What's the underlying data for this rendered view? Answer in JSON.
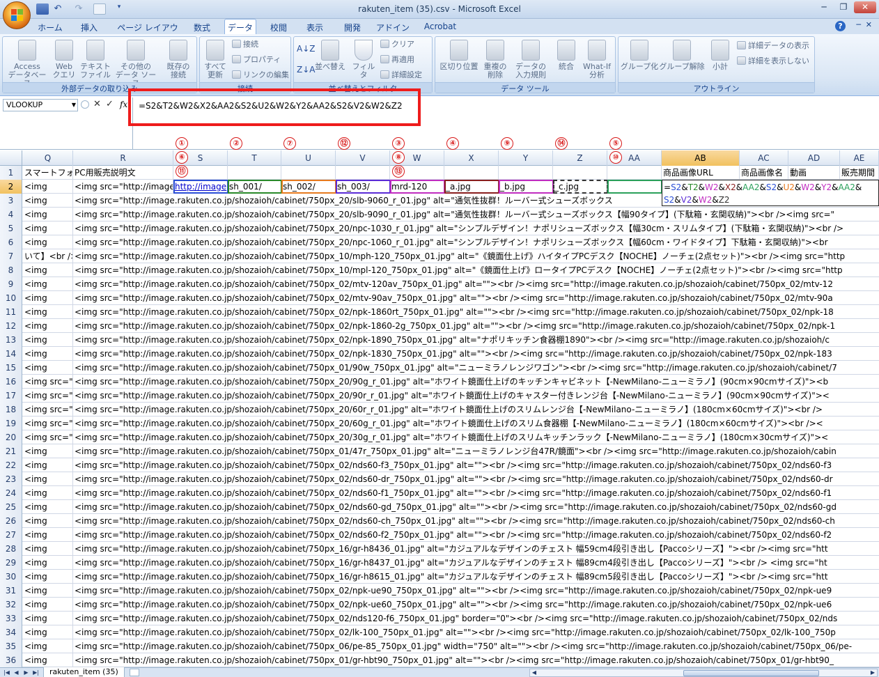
{
  "window": {
    "title": "rakuten_item (35).csv - Microsoft Excel",
    "controls": {
      "minimize": "─",
      "maximize": "❐",
      "close": "✕"
    }
  },
  "ribbon_tabs": [
    "ホーム",
    "挿入",
    "ページ レイアウト",
    "数式",
    "データ",
    "校閲",
    "表示",
    "開発",
    "アドイン",
    "Acrobat"
  ],
  "active_tab": "データ",
  "help": "?",
  "ribbon": {
    "external_data": {
      "label": "外部データの取り込み",
      "access": [
        "Access",
        "データベース"
      ],
      "web": [
        "Web",
        "クエリ"
      ],
      "text": [
        "テキスト",
        "ファイル"
      ],
      "other": [
        "その他の",
        "データ ソース"
      ],
      "existing": [
        "既存の",
        "接続"
      ]
    },
    "connections": {
      "label": "接続",
      "refresh_all": [
        "すべて",
        "更新"
      ],
      "connect": "接続",
      "properties": "プロパティ",
      "edit_links": "リンクの編集"
    },
    "sort_filter": {
      "label": "並べ替えとフィルタ",
      "sort": "並べ替え",
      "filter": "フィルタ",
      "clear": "クリア",
      "reapply": "再適用",
      "advanced": "詳細設定"
    },
    "data_tools": {
      "label": "データ ツール",
      "text_to_columns": "区切り位置",
      "remove_dup": [
        "重複の",
        "削除"
      ],
      "validation": [
        "データの",
        "入力規則"
      ],
      "consolidate": "統合",
      "whatif": [
        "What-If",
        "分析"
      ]
    },
    "outline": {
      "label": "アウトライン",
      "group": "グループ化",
      "ungroup": "グループ解除",
      "subtotal": "小計",
      "show_detail": "詳細データの表示",
      "hide_detail": "詳細を表示しない"
    }
  },
  "name_box": "VLOOKUP",
  "fx_symbols": {
    "cancel": "✕",
    "enter": "✓",
    "fx": "fx"
  },
  "formula": "=S2&T2&W2&X2&AA2&S2&U2&W2&Y2&AA2&S2&V2&W2&Z2",
  "columns": [
    "Q",
    "R",
    "S",
    "T",
    "U",
    "V",
    "W",
    "X",
    "Y",
    "Z",
    "AA",
    "AB",
    "AC",
    "AD",
    "AE"
  ],
  "selected_column": "AB",
  "selected_row": "2",
  "row1": {
    "Q": "スマートフォ",
    "R": "PC用販売説明文",
    "AB": "商品画像URL",
    "AC": "商品画像名",
    "AD": "動画",
    "AE": "販売期間"
  },
  "row2": {
    "Q": "<img",
    "R": "<img src=\"http://image",
    "S": "http://image",
    "T": "sh_001/",
    "U": "sh_002/",
    "V": "sh_003/",
    "W": "mrd-120",
    "X": "_a.jpg",
    "Y": "_b.jpg",
    "Z": "_c.jpg",
    "AB_line1": "=S2&T2&W2&X2&AA2&S2&U2&W2&Y2&AA2&",
    "AB_line2": "S2&V2&W2&Z2"
  },
  "circled_numbers": {
    "S": [
      "①",
      "⑥",
      "⑪"
    ],
    "T": [
      "②"
    ],
    "U": [
      "⑦"
    ],
    "V": [
      "⑫"
    ],
    "W": [
      "③",
      "⑧",
      "⑬"
    ],
    "X": [
      "④"
    ],
    "Y": [
      "⑨"
    ],
    "Z": [
      "⑭"
    ],
    "AA": [
      "⑤",
      "⑩"
    ]
  },
  "rows": [
    {
      "n": "3",
      "q": "<img",
      "r": "<img src=\"http://image.rakuten.co.jp/shozaioh/cabinet/750px_20/slb-9060_r_01.jpg\" alt=\"通気性抜群！ルーバー式シューズボックス"
    },
    {
      "n": "4",
      "q": "<img",
      "r": "<img src=\"http://image.rakuten.co.jp/shozaioh/cabinet/750px_20/slb-9090_r_01.jpg\" alt=\"通気性抜群！ルーバー式シューズボックス【幅90タイプ】(下駄箱・玄関収納)\"><br /><img src=\""
    },
    {
      "n": "5",
      "q": "<img",
      "r": "<img src=\"http://image.rakuten.co.jp/shozaioh/cabinet/750px_20/npc-1030_r_01.jpg\" alt=\"シンプルデザイン！ナポリシューズボックス【幅30cm・スリムタイプ】(下駄箱・玄関収納)\"><br />"
    },
    {
      "n": "6",
      "q": "<img",
      "r": "<img src=\"http://image.rakuten.co.jp/shozaioh/cabinet/750px_20/npc-1060_r_01.jpg\" alt=\"シンプルデザイン！ナポリシューズボックス【幅60cm・ワイドタイプ】下駄箱・玄関収納)\"><br"
    },
    {
      "n": "7",
      "q": "いて】<br />",
      "r": "<img src=\"http://image.rakuten.co.jp/shozaioh/cabinet/750px_10/mph-120_750px_01.jpg\" alt=\"《鏡面仕上げ》ハイタイプPCデスク【NOCHE】ノーチェ(2点セット)\"><br /><img src=\"http"
    },
    {
      "n": "8",
      "q": "<img",
      "r": "<img src=\"http://image.rakuten.co.jp/shozaioh/cabinet/750px_10/mpl-120_750px_01.jpg\" alt=\"《鏡面仕上げ》ロータイプPCデスク【NOCHE】ノーチェ(2点セット)\"><br /><img src=\"http"
    },
    {
      "n": "9",
      "q": "<img",
      "r": "<img src=\"http://image.rakuten.co.jp/shozaioh/cabinet/750px_02/mtv-120av_750px_01.jpg\" alt=\"\"><br /><img src=\"http://image.rakuten.co.jp/shozaioh/cabinet/750px_02/mtv-12"
    },
    {
      "n": "10",
      "q": "<img",
      "r": "<img src=\"http://image.rakuten.co.jp/shozaioh/cabinet/750px_02/mtv-90av_750px_01.jpg\" alt=\"\"><br /><img src=\"http://image.rakuten.co.jp/shozaioh/cabinet/750px_02/mtv-90a"
    },
    {
      "n": "11",
      "q": "<img",
      "r": "<img src=\"http://image.rakuten.co.jp/shozaioh/cabinet/750px_02/npk-1860rt_750px_01.jpg\" alt=\"\"><br /><img src=\"http://image.rakuten.co.jp/shozaioh/cabinet/750px_02/npk-18"
    },
    {
      "n": "12",
      "q": "<img",
      "r": "<img src=\"http://image.rakuten.co.jp/shozaioh/cabinet/750px_02/npk-1860-2g_750px_01.jpg\" alt=\"\"><br /><img src=\"http://image.rakuten.co.jp/shozaioh/cabinet/750px_02/npk-1"
    },
    {
      "n": "13",
      "q": "<img",
      "r": "<img src=\"http://image.rakuten.co.jp/shozaioh/cabinet/750px_02/npk-1890_750px_01.jpg\" alt=\"ナポリキッチン食器棚1890\"><br /><img src=\"http://image.rakuten.co.jp/shozaioh/c"
    },
    {
      "n": "14",
      "q": "<img",
      "r": "<img src=\"http://image.rakuten.co.jp/shozaioh/cabinet/750px_02/npk-1830_750px_01.jpg\" alt=\"\"><br /><img src=\"http://image.rakuten.co.jp/shozaioh/cabinet/750px_02/npk-183"
    },
    {
      "n": "15",
      "q": "<img",
      "r": "<img src=\"http://image.rakuten.co.jp/shozaioh/cabinet/750px_01/90w_750px_01.jpg\" alt=\"ニューミラノレンジワゴン\"><br /><img src=\"http://image.rakuten.co.jp/shozaioh/cabinet/7"
    },
    {
      "n": "16",
      "q": "<img src=\"",
      "r": "<img src=\"http://image.rakuten.co.jp/shozaioh/cabinet/750px_20/90g_r_01.jpg\" alt=\"ホワイト鏡面仕上げのキッチンキャビネット【-NewMilano-ニューミラノ】(90cm×90cmサイズ)\"><b"
    },
    {
      "n": "17",
      "q": "<img src=\"",
      "r": "<img src=\"http://image.rakuten.co.jp/shozaioh/cabinet/750px_20/90r_r_01.jpg\" alt=\"ホワイト鏡面仕上げのキャスター付きレンジ台【-NewMilano-ニューミラノ】(90cm×90cmサイズ)\"><"
    },
    {
      "n": "18",
      "q": "<img src=\"",
      "r": "<img src=\"http://image.rakuten.co.jp/shozaioh/cabinet/750px_20/60r_r_01.jpg\" alt=\"ホワイト鏡面仕上げのスリムレンジ台【-NewMilano-ニューミラノ】(180cm×60cmサイズ)\"><br />"
    },
    {
      "n": "19",
      "q": "<img src=\"",
      "r": "<img src=\"http://image.rakuten.co.jp/shozaioh/cabinet/750px_20/60g_r_01.jpg\" alt=\"ホワイト鏡面仕上げのスリム食器棚【-NewMilano-ニューミラノ】(180cm×60cmサイズ)\"><br /><"
    },
    {
      "n": "20",
      "q": "<img src=\"",
      "r": "<img src=\"http://image.rakuten.co.jp/shozaioh/cabinet/750px_20/30g_r_01.jpg\" alt=\"ホワイト鏡面仕上げのスリムキッチンラック【-NewMilano-ニューミラノ】(180cm×30cmサイズ)\"><"
    },
    {
      "n": "21",
      "q": "<img",
      "r": "<img src=\"http://image.rakuten.co.jp/shozaioh/cabinet/750px_01/47r_750px_01.jpg\" alt=\"ニューミラノレンジ台47R/鏡面\"><br /><img src=\"http://image.rakuten.co.jp/shozaioh/cabin"
    },
    {
      "n": "22",
      "q": "<img",
      "r": "<img src=\"http://image.rakuten.co.jp/shozaioh/cabinet/750px_02/nds60-f3_750px_01.jpg\" alt=\"\"><br /><img src=\"http://image.rakuten.co.jp/shozaioh/cabinet/750px_02/nds60-f3"
    },
    {
      "n": "23",
      "q": "<img",
      "r": "<img src=\"http://image.rakuten.co.jp/shozaioh/cabinet/750px_02/nds60-dr_750px_01.jpg\" alt=\"\"><br /><img src=\"http://image.rakuten.co.jp/shozaioh/cabinet/750px_02/nds60-dr"
    },
    {
      "n": "24",
      "q": "<img",
      "r": "<img src=\"http://image.rakuten.co.jp/shozaioh/cabinet/750px_02/nds60-f1_750px_01.jpg\" alt=\"\"><br /><img src=\"http://image.rakuten.co.jp/shozaioh/cabinet/750px_02/nds60-f1"
    },
    {
      "n": "25",
      "q": "<img",
      "r": "<img src=\"http://image.rakuten.co.jp/shozaioh/cabinet/750px_02/nds60-gd_750px_01.jpg\" alt=\"\"><br /><img src=\"http://image.rakuten.co.jp/shozaioh/cabinet/750px_02/nds60-gd"
    },
    {
      "n": "26",
      "q": "<img",
      "r": "<img src=\"http://image.rakuten.co.jp/shozaioh/cabinet/750px_02/nds60-ch_750px_01.jpg\" alt=\"\"><br /><img src=\"http://image.rakuten.co.jp/shozaioh/cabinet/750px_02/nds60-ch"
    },
    {
      "n": "27",
      "q": "<img",
      "r": "<img src=\"http://image.rakuten.co.jp/shozaioh/cabinet/750px_02/nds60-f2_750px_01.jpg\" alt=\"\"><br /><img src=\"http://image.rakuten.co.jp/shozaioh/cabinet/750px_02/nds60-f2"
    },
    {
      "n": "28",
      "q": "<img",
      "r": "<img src=\"http://image.rakuten.co.jp/shozaioh/cabinet/750px_16/gr-h8436_01.jpg\" alt=\"カジュアルなデザインのチェスト 幅59cm4段引き出し【Paccoシリーズ】\"><br /><img src=\"htt"
    },
    {
      "n": "29",
      "q": "<img",
      "r": "<img src=\"http://image.rakuten.co.jp/shozaioh/cabinet/750px_16/gr-h8437_01.jpg\" alt=\"カジュアルなデザインのチェスト 幅89cm4段引き出し【Paccoシリーズ】\"><br /> <img src=\"ht"
    },
    {
      "n": "30",
      "q": "<img",
      "r": "<img src=\"http://image.rakuten.co.jp/shozaioh/cabinet/750px_16/gr-h8615_01.jpg\" alt=\"カジュアルなデザインのチェスト 幅89cm5段引き出し【Paccoシリーズ】\"><br /><img src=\"htt"
    },
    {
      "n": "31",
      "q": "<img",
      "r": "<img src=\"http://image.rakuten.co.jp/shozaioh/cabinet/750px_02/npk-ue90_750px_01.jpg\" alt=\"\"><br /><img src=\"http://image.rakuten.co.jp/shozaioh/cabinet/750px_02/npk-ue9"
    },
    {
      "n": "32",
      "q": "<img",
      "r": "<img src=\"http://image.rakuten.co.jp/shozaioh/cabinet/750px_02/npk-ue60_750px_01.jpg\" alt=\"\"><br /><img src=\"http://image.rakuten.co.jp/shozaioh/cabinet/750px_02/npk-ue6"
    },
    {
      "n": "33",
      "q": "<img",
      "r": "<img src=\"http://image.rakuten.co.jp/shozaioh/cabinet/750px_02/nds120-f6_750px_01.jpg\" border=\"0\"><br /><img src=\"http://image.rakuten.co.jp/shozaioh/cabinet/750px_02/nds"
    },
    {
      "n": "34",
      "q": "<img",
      "r": "<img src=\"http://image.rakuten.co.jp/shozaioh/cabinet/750px_02/lk-100_750px_01.jpg\" alt=\"\"><br /><img src=\"http://image.rakuten.co.jp/shozaioh/cabinet/750px_02/lk-100_750p"
    },
    {
      "n": "35",
      "q": "<img",
      "r": "<img src=\"http://image.rakuten.co.jp/shozaioh/cabinet/750px_06/pe-85_750px_01.jpg\" width=\"750\" alt=\"\"><br /><img src=\"http://image.rakuten.co.jp/shozaioh/cabinet/750px_06/pe-"
    },
    {
      "n": "36",
      "q": "<img",
      "r": "<img src=\"http://image.rakuten.co.jp/shozaioh/cabinet/750px_01/gr-hbt90_750px_01.jpg\" alt=\"\"><br /><img src=\"http://image.rakuten.co.jp/shozaioh/cabinet/750px_01/gr-hbt90_"
    }
  ],
  "sheet_tab": "rakuten_item (35)",
  "nav_arrows": [
    "|◀",
    "◀",
    "▶",
    "▶|"
  ],
  "colors": {
    "accent": "#15428b",
    "ribbon_bg": "#dbe7f5",
    "selection": "#f1c15f",
    "red_annotation": "#ee1c1c"
  }
}
